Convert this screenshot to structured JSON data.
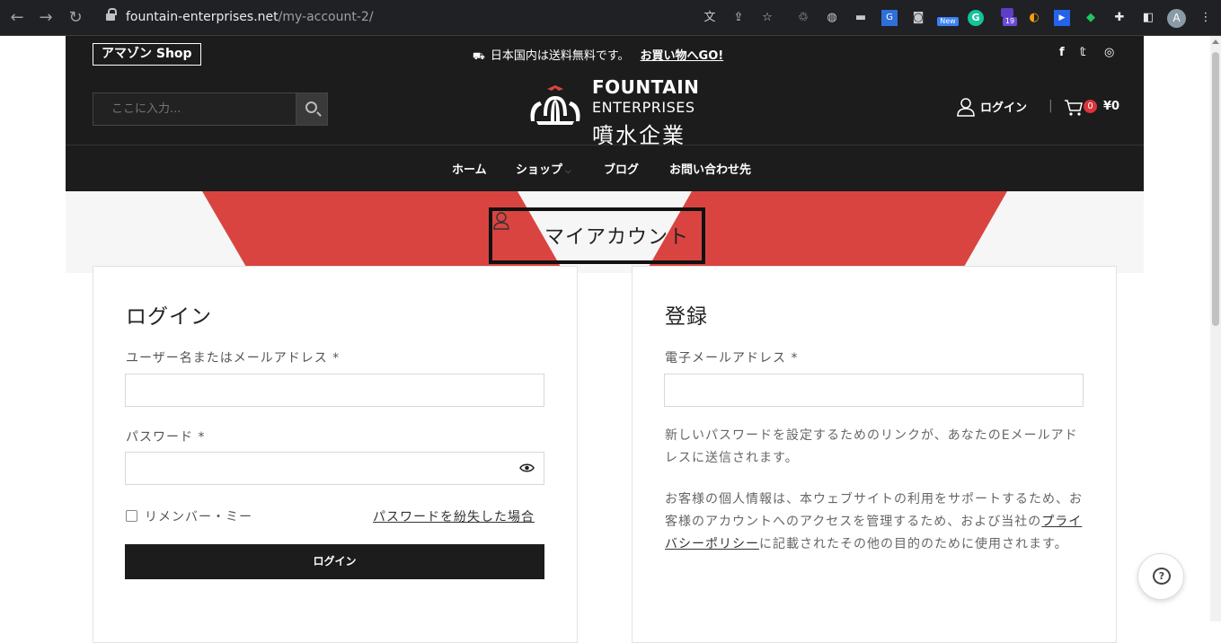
{
  "browser": {
    "url_host": "fountain-enterprises.net",
    "url_path": "/my-account-2/",
    "profile_initial": "A",
    "extension_badges": {
      "new": "New",
      "count": "19"
    }
  },
  "topbar": {
    "amazon_label": "アマゾン Shop",
    "shipping_text": "日本国内は送料無料です。",
    "shop_link": "お買い物へGO!",
    "social": [
      "f",
      "𝕥",
      "◎"
    ]
  },
  "header": {
    "search_placeholder": "ここに入力...",
    "brand_line1": "FOUNTAIN",
    "brand_line2": "ENTERPRISES",
    "brand_line3": "噴水企業",
    "login_label": "ログイン",
    "separator": "|",
    "cart_count": "0",
    "cart_total": "¥0"
  },
  "nav": {
    "items": [
      "ホーム",
      "ショップ",
      "ブログ",
      "お問い合わせ先"
    ]
  },
  "banner": {
    "title": "マイアカウント"
  },
  "login": {
    "heading": "ログイン",
    "username_label": "ユーザー名またはメールアドレス *",
    "password_label": "パスワード *",
    "remember_label": "リメンバー・ミー",
    "lost_password": "パスワードを紛失した場合",
    "submit_label": "ログイン"
  },
  "register": {
    "heading": "登録",
    "email_label": "電子メールアドレス *",
    "info_text": "新しいパスワードを設定するためのリンクが、あなたのEメールアドレスに送信されます。",
    "privacy_before": "お客様の個人情報は、本ウェブサイトの利用をサポートするため、お客様のアカウントへのアクセスを管理するため、および当社の",
    "privacy_link": "プライバシーポリシー",
    "privacy_after": "に記載されたその他の目的のために使用されます。"
  },
  "colors": {
    "dark": "#1c1c1c",
    "accent_red": "#d94440",
    "badge_red": "#d9353a"
  }
}
